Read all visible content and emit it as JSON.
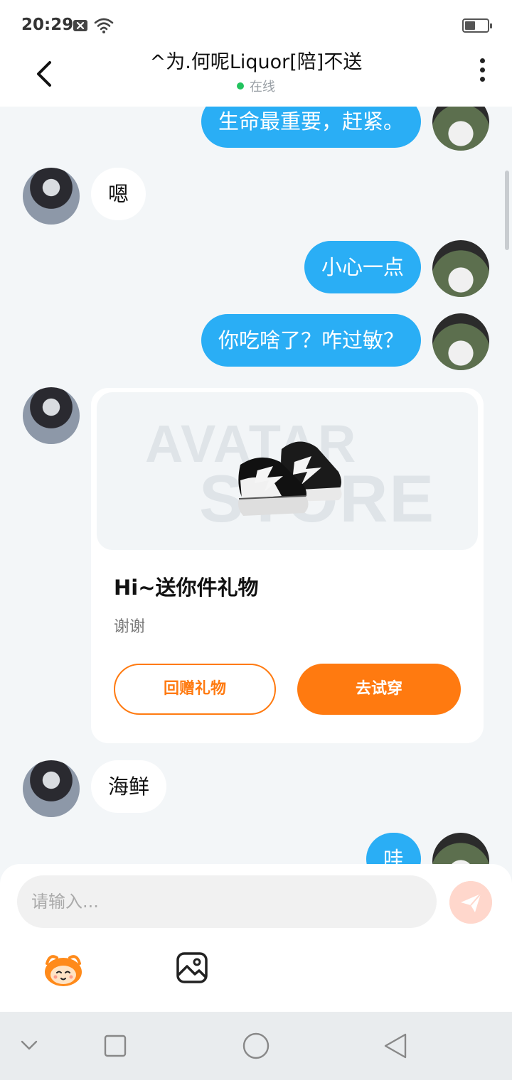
{
  "status_bar": {
    "time": "20:29"
  },
  "header": {
    "title": "^为.何呢Liquor[陪]不送",
    "status": "在线"
  },
  "messages": [
    {
      "text": "生命最重要，赶紧。"
    },
    {
      "text": "嗯"
    },
    {
      "text": "小心一点"
    },
    {
      "text": "你吃啥了？咋过敏？"
    },
    {
      "text": "海鲜"
    },
    {
      "text": "哇"
    }
  ],
  "gift_card": {
    "watermark_top": "AVATAR",
    "watermark_bottom": "STORE",
    "title": "Hi~送你件礼物",
    "description": "谢谢",
    "return_gift_label": "回赠礼物",
    "try_on_label": "去试穿"
  },
  "input": {
    "placeholder": "请输入..."
  },
  "colors": {
    "my_bubble": "#2aaef5",
    "accent_orange": "#ff7a10",
    "online": "#22c35e",
    "send_inactive": "#ffd7cc"
  },
  "icons": {
    "back": "chevron-left-icon",
    "more": "more-vertical-icon",
    "send": "send-icon",
    "emoji": "emoji-mascot-icon",
    "image": "image-icon"
  }
}
